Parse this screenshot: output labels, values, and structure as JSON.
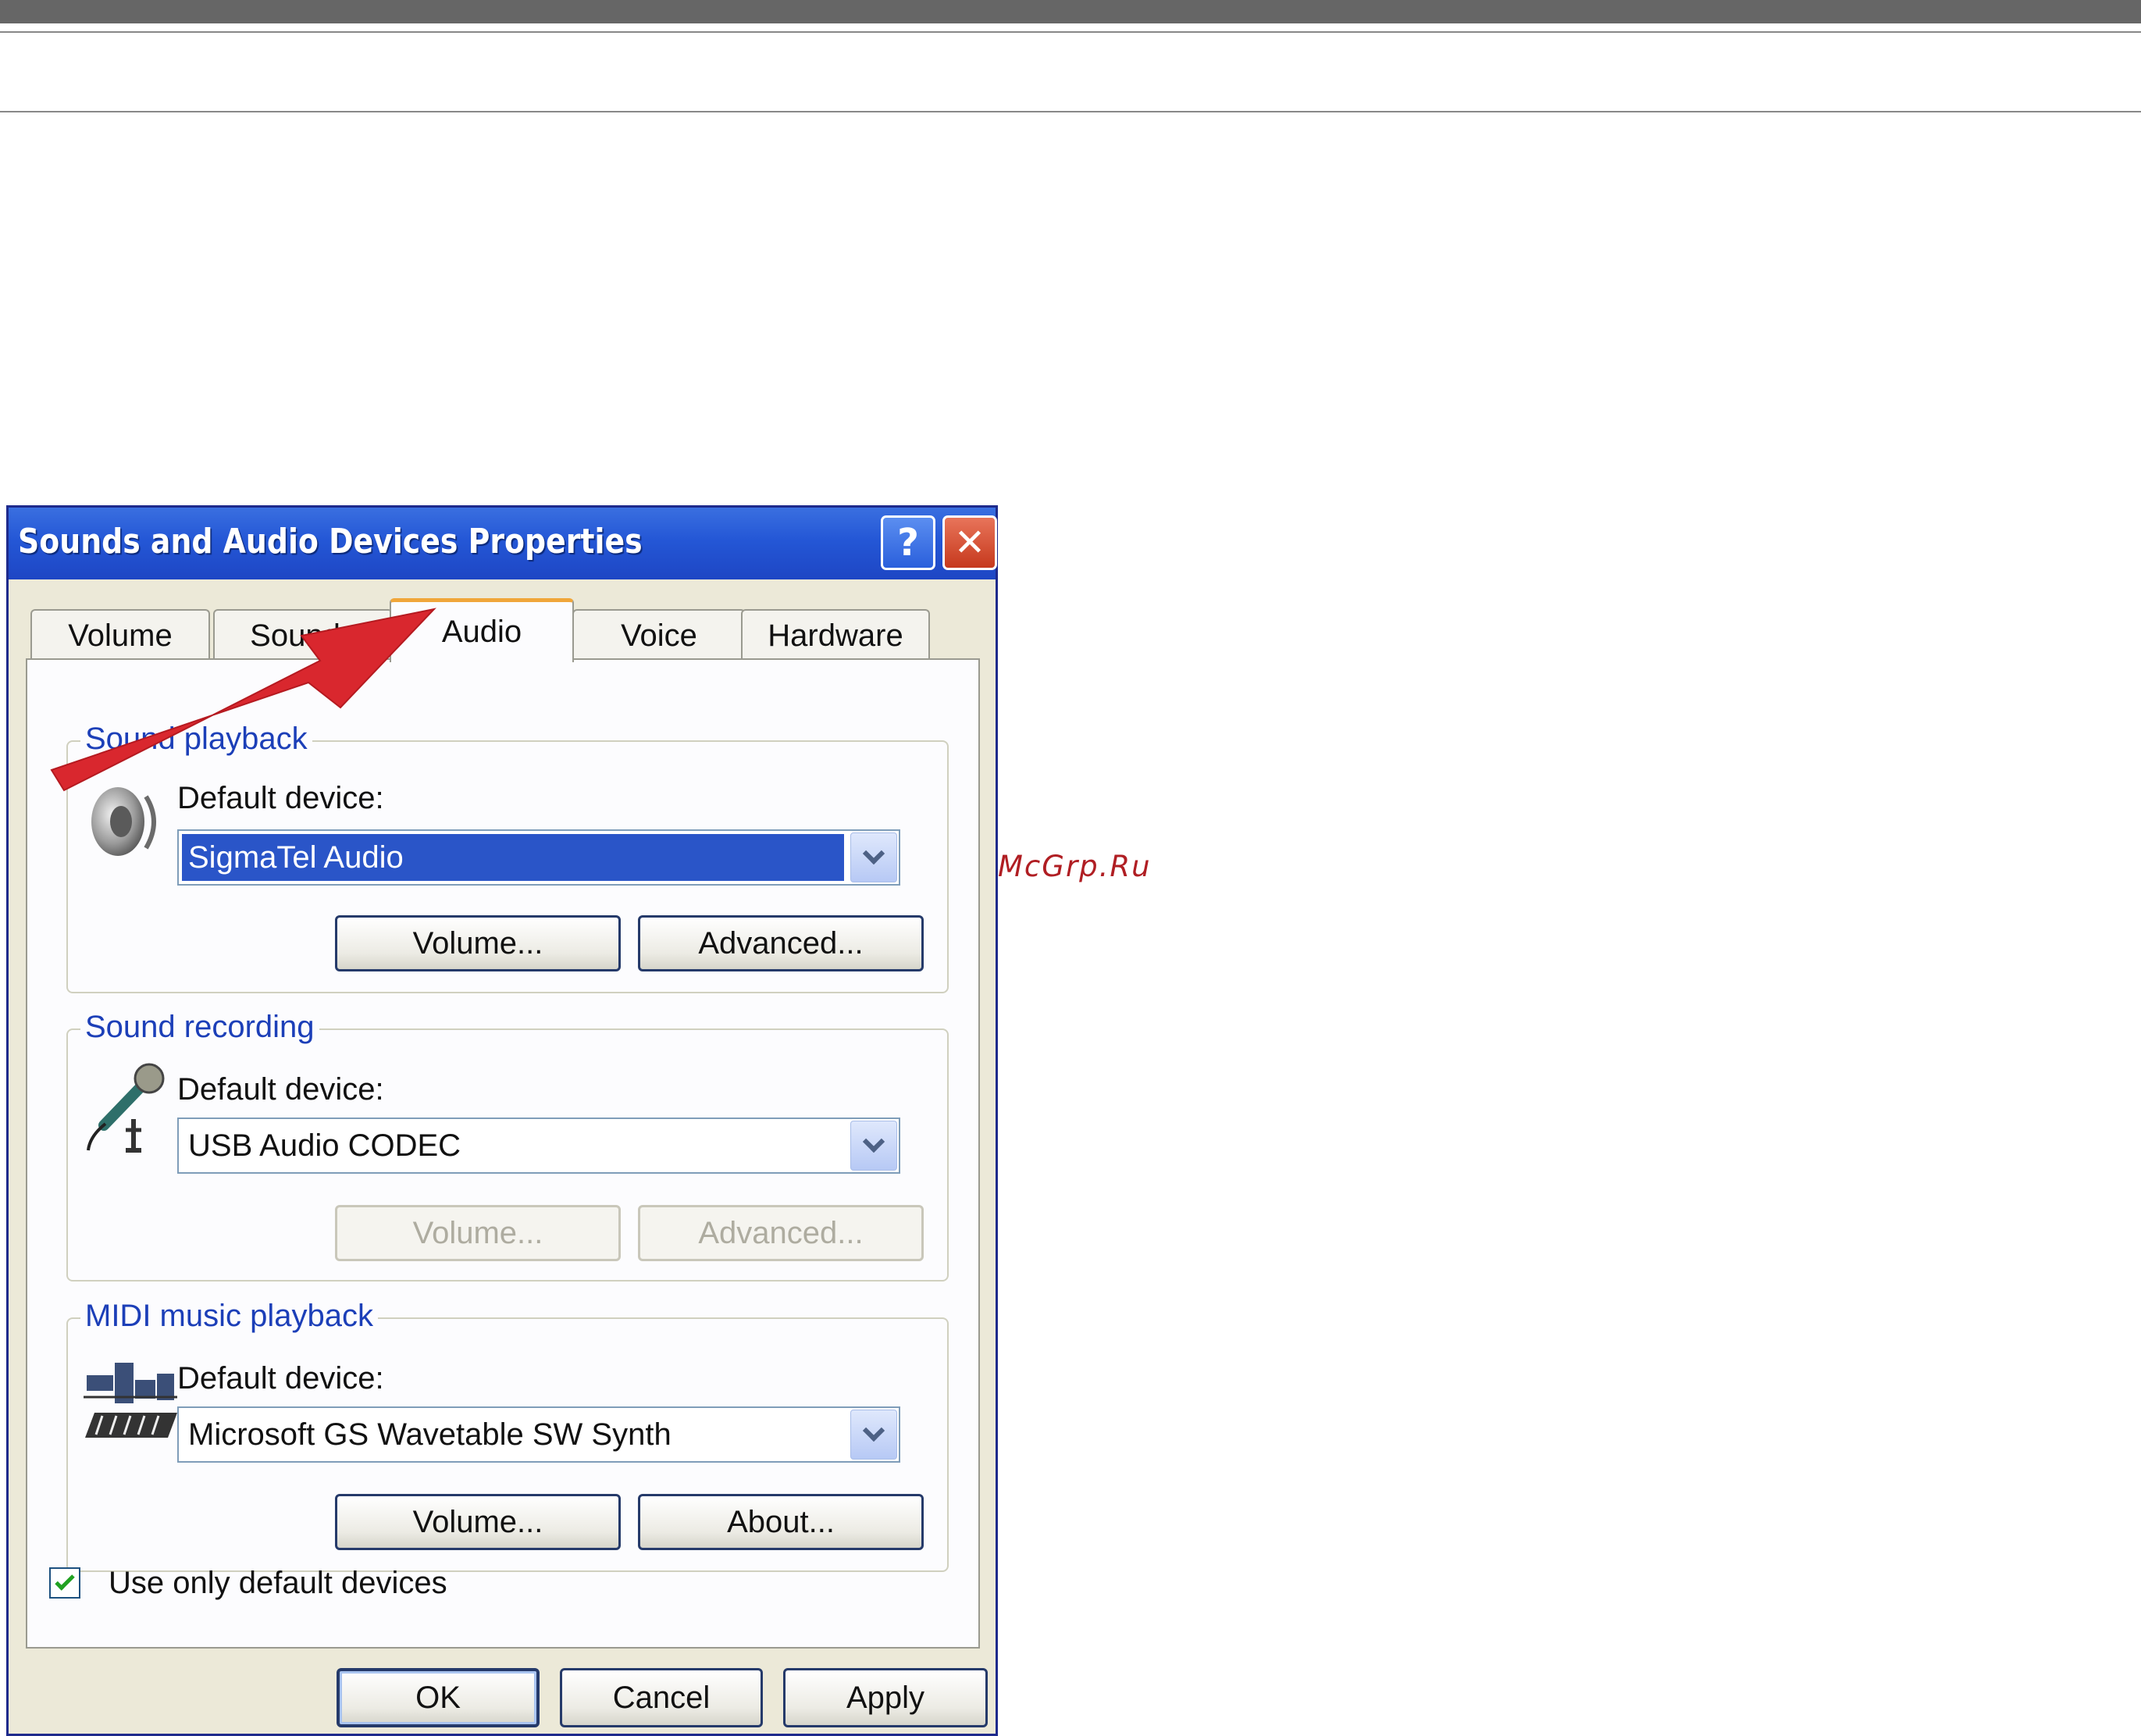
{
  "watermark": {
    "text": "McGrp.Ru",
    "color": "#b01e23"
  },
  "dialog": {
    "title": "Sounds and Audio Devices Properties",
    "help_label": "?",
    "close_label": "✕",
    "tabs": [
      {
        "label": "Volume",
        "active": false
      },
      {
        "label": "Sounds",
        "active": false
      },
      {
        "label": "Audio",
        "active": true
      },
      {
        "label": "Voice",
        "active": false
      },
      {
        "label": "Hardware",
        "active": false
      }
    ],
    "sound_playback": {
      "legend": "Sound playback",
      "default_device_label": "Default device:",
      "device": "SigmaTel Audio",
      "volume_label": "Volume...",
      "advanced_label": "Advanced...",
      "icon": "speaker-icon"
    },
    "sound_recording": {
      "legend": "Sound recording",
      "default_device_label": "Default device:",
      "device": "USB Audio CODEC",
      "volume_label": "Volume...",
      "advanced_label": "Advanced...",
      "buttons_disabled": true,
      "icon": "microphone-icon"
    },
    "midi_playback": {
      "legend": "MIDI music playback",
      "default_device_label": "Default device:",
      "device": "Microsoft GS Wavetable SW Synth",
      "volume_label": "Volume...",
      "about_label": "About...",
      "icon": "midi-keyboard-icon"
    },
    "use_only_default": {
      "label": "Use only default devices",
      "checked": true
    },
    "ok_label": "OK",
    "cancel_label": "Cancel",
    "apply_label": "Apply"
  },
  "annotation": {
    "icon": "red-arrow-pointer",
    "color": "#d9272e"
  },
  "colors": {
    "titlebar": "#2457d6",
    "dialog_face": "#ece9d8",
    "legend_text": "#1c3fb8",
    "selection": "#2a55c8"
  }
}
